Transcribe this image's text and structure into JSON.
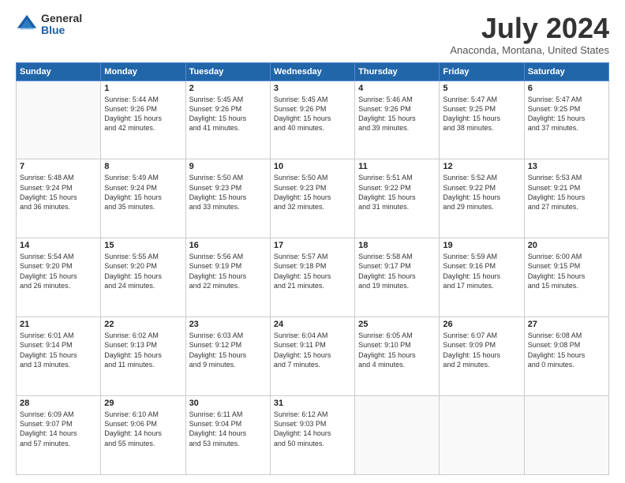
{
  "header": {
    "logo_general": "General",
    "logo_blue": "Blue",
    "month_year": "July 2024",
    "location": "Anaconda, Montana, United States"
  },
  "days_of_week": [
    "Sunday",
    "Monday",
    "Tuesday",
    "Wednesday",
    "Thursday",
    "Friday",
    "Saturday"
  ],
  "weeks": [
    [
      {
        "day": "",
        "info": ""
      },
      {
        "day": "1",
        "info": "Sunrise: 5:44 AM\nSunset: 9:26 PM\nDaylight: 15 hours\nand 42 minutes."
      },
      {
        "day": "2",
        "info": "Sunrise: 5:45 AM\nSunset: 9:26 PM\nDaylight: 15 hours\nand 41 minutes."
      },
      {
        "day": "3",
        "info": "Sunrise: 5:45 AM\nSunset: 9:26 PM\nDaylight: 15 hours\nand 40 minutes."
      },
      {
        "day": "4",
        "info": "Sunrise: 5:46 AM\nSunset: 9:26 PM\nDaylight: 15 hours\nand 39 minutes."
      },
      {
        "day": "5",
        "info": "Sunrise: 5:47 AM\nSunset: 9:25 PM\nDaylight: 15 hours\nand 38 minutes."
      },
      {
        "day": "6",
        "info": "Sunrise: 5:47 AM\nSunset: 9:25 PM\nDaylight: 15 hours\nand 37 minutes."
      }
    ],
    [
      {
        "day": "7",
        "info": "Sunrise: 5:48 AM\nSunset: 9:24 PM\nDaylight: 15 hours\nand 36 minutes."
      },
      {
        "day": "8",
        "info": "Sunrise: 5:49 AM\nSunset: 9:24 PM\nDaylight: 15 hours\nand 35 minutes."
      },
      {
        "day": "9",
        "info": "Sunrise: 5:50 AM\nSunset: 9:23 PM\nDaylight: 15 hours\nand 33 minutes."
      },
      {
        "day": "10",
        "info": "Sunrise: 5:50 AM\nSunset: 9:23 PM\nDaylight: 15 hours\nand 32 minutes."
      },
      {
        "day": "11",
        "info": "Sunrise: 5:51 AM\nSunset: 9:22 PM\nDaylight: 15 hours\nand 31 minutes."
      },
      {
        "day": "12",
        "info": "Sunrise: 5:52 AM\nSunset: 9:22 PM\nDaylight: 15 hours\nand 29 minutes."
      },
      {
        "day": "13",
        "info": "Sunrise: 5:53 AM\nSunset: 9:21 PM\nDaylight: 15 hours\nand 27 minutes."
      }
    ],
    [
      {
        "day": "14",
        "info": "Sunrise: 5:54 AM\nSunset: 9:20 PM\nDaylight: 15 hours\nand 26 minutes."
      },
      {
        "day": "15",
        "info": "Sunrise: 5:55 AM\nSunset: 9:20 PM\nDaylight: 15 hours\nand 24 minutes."
      },
      {
        "day": "16",
        "info": "Sunrise: 5:56 AM\nSunset: 9:19 PM\nDaylight: 15 hours\nand 22 minutes."
      },
      {
        "day": "17",
        "info": "Sunrise: 5:57 AM\nSunset: 9:18 PM\nDaylight: 15 hours\nand 21 minutes."
      },
      {
        "day": "18",
        "info": "Sunrise: 5:58 AM\nSunset: 9:17 PM\nDaylight: 15 hours\nand 19 minutes."
      },
      {
        "day": "19",
        "info": "Sunrise: 5:59 AM\nSunset: 9:16 PM\nDaylight: 15 hours\nand 17 minutes."
      },
      {
        "day": "20",
        "info": "Sunrise: 6:00 AM\nSunset: 9:15 PM\nDaylight: 15 hours\nand 15 minutes."
      }
    ],
    [
      {
        "day": "21",
        "info": "Sunrise: 6:01 AM\nSunset: 9:14 PM\nDaylight: 15 hours\nand 13 minutes."
      },
      {
        "day": "22",
        "info": "Sunrise: 6:02 AM\nSunset: 9:13 PM\nDaylight: 15 hours\nand 11 minutes."
      },
      {
        "day": "23",
        "info": "Sunrise: 6:03 AM\nSunset: 9:12 PM\nDaylight: 15 hours\nand 9 minutes."
      },
      {
        "day": "24",
        "info": "Sunrise: 6:04 AM\nSunset: 9:11 PM\nDaylight: 15 hours\nand 7 minutes."
      },
      {
        "day": "25",
        "info": "Sunrise: 6:05 AM\nSunset: 9:10 PM\nDaylight: 15 hours\nand 4 minutes."
      },
      {
        "day": "26",
        "info": "Sunrise: 6:07 AM\nSunset: 9:09 PM\nDaylight: 15 hours\nand 2 minutes."
      },
      {
        "day": "27",
        "info": "Sunrise: 6:08 AM\nSunset: 9:08 PM\nDaylight: 15 hours\nand 0 minutes."
      }
    ],
    [
      {
        "day": "28",
        "info": "Sunrise: 6:09 AM\nSunset: 9:07 PM\nDaylight: 14 hours\nand 57 minutes."
      },
      {
        "day": "29",
        "info": "Sunrise: 6:10 AM\nSunset: 9:06 PM\nDaylight: 14 hours\nand 55 minutes."
      },
      {
        "day": "30",
        "info": "Sunrise: 6:11 AM\nSunset: 9:04 PM\nDaylight: 14 hours\nand 53 minutes."
      },
      {
        "day": "31",
        "info": "Sunrise: 6:12 AM\nSunset: 9:03 PM\nDaylight: 14 hours\nand 50 minutes."
      },
      {
        "day": "",
        "info": ""
      },
      {
        "day": "",
        "info": ""
      },
      {
        "day": "",
        "info": ""
      }
    ]
  ]
}
